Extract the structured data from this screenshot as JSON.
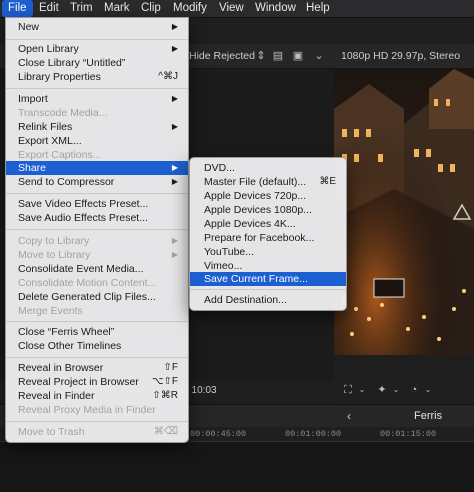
{
  "menubar": {
    "items": [
      "File",
      "Edit",
      "Trim",
      "Mark",
      "Clip",
      "Modify",
      "View",
      "Window",
      "Help"
    ]
  },
  "browser_toolbar": {
    "filter": "Hide Rejected"
  },
  "viewer_toolbar": {
    "format": "1080p HD 29.97p, Stereo"
  },
  "browser_status": {
    "text": ", 10:03"
  },
  "timeline": {
    "name": "Ferris Wheel",
    "ruler": [
      "00:00:45:00",
      "00:01:00:00",
      "00:01:15:00"
    ]
  },
  "file_menu": {
    "items": [
      {
        "label": "New",
        "shortcut": "",
        "submenu": true,
        "disabled": false
      },
      {
        "label": "Open Library",
        "shortcut": "",
        "submenu": true,
        "disabled": false
      },
      {
        "label": "Close Library “Untitled”",
        "shortcut": "",
        "submenu": false,
        "disabled": false
      },
      {
        "label": "Library Properties",
        "shortcut": "^⌘J",
        "submenu": false,
        "disabled": false
      },
      {
        "label": "Import",
        "shortcut": "",
        "submenu": true,
        "disabled": false
      },
      {
        "label": "Transcode Media...",
        "shortcut": "",
        "submenu": false,
        "disabled": true
      },
      {
        "label": "Relink Files",
        "shortcut": "",
        "submenu": true,
        "disabled": false
      },
      {
        "label": "Export XML...",
        "shortcut": "",
        "submenu": false,
        "disabled": false
      },
      {
        "label": "Export Captions...",
        "shortcut": "",
        "submenu": false,
        "disabled": true
      },
      {
        "label": "Share",
        "shortcut": "",
        "submenu": true,
        "disabled": false,
        "highlighted": true
      },
      {
        "label": "Send to Compressor",
        "shortcut": "",
        "submenu": true,
        "disabled": false
      },
      {
        "label": "Save Video Effects Preset...",
        "shortcut": "",
        "submenu": false,
        "disabled": false
      },
      {
        "label": "Save Audio Effects Preset...",
        "shortcut": "",
        "submenu": false,
        "disabled": false
      },
      {
        "label": "Copy to Library",
        "shortcut": "",
        "submenu": true,
        "disabled": true
      },
      {
        "label": "Move to Library",
        "shortcut": "",
        "submenu": true,
        "disabled": true
      },
      {
        "label": "Consolidate Event Media...",
        "shortcut": "",
        "submenu": false,
        "disabled": false
      },
      {
        "label": "Consolidate Motion Content...",
        "shortcut": "",
        "submenu": false,
        "disabled": true
      },
      {
        "label": "Delete Generated Clip Files...",
        "shortcut": "",
        "submenu": false,
        "disabled": false
      },
      {
        "label": "Merge Events",
        "shortcut": "",
        "submenu": false,
        "disabled": true
      },
      {
        "label": "Close “Ferris Wheel”",
        "shortcut": "",
        "submenu": false,
        "disabled": false
      },
      {
        "label": "Close Other Timelines",
        "shortcut": "",
        "submenu": false,
        "disabled": false
      },
      {
        "label": "Reveal in Browser",
        "shortcut": "⇧F",
        "submenu": false,
        "disabled": false
      },
      {
        "label": "Reveal Project in Browser",
        "shortcut": "⌥⇧F",
        "submenu": false,
        "disabled": false
      },
      {
        "label": "Reveal in Finder",
        "shortcut": "⇧⌘R",
        "submenu": false,
        "disabled": false
      },
      {
        "label": "Reveal Proxy Media in Finder",
        "shortcut": "",
        "submenu": false,
        "disabled": true
      },
      {
        "label": "Move to Trash",
        "shortcut": "⌘⌫",
        "submenu": false,
        "disabled": true
      }
    ]
  },
  "share_menu": {
    "items": [
      {
        "label": "DVD...",
        "shortcut": ""
      },
      {
        "label": "Master File (default)...",
        "shortcut": "⌘E"
      },
      {
        "label": "Apple Devices 720p...",
        "shortcut": ""
      },
      {
        "label": "Apple Devices 1080p...",
        "shortcut": ""
      },
      {
        "label": "Apple Devices 4K...",
        "shortcut": ""
      },
      {
        "label": "Prepare for Facebook...",
        "shortcut": ""
      },
      {
        "label": "YouTube...",
        "shortcut": ""
      },
      {
        "label": "Vimeo...",
        "shortcut": ""
      },
      {
        "label": "Save Current Frame...",
        "shortcut": "",
        "highlighted": true
      },
      {
        "label": "Add Destination...",
        "shortcut": ""
      }
    ]
  },
  "colors": {
    "highlight": "#1c5fd0",
    "menu_bg": "#ececee",
    "app_bg": "#1e1e1e"
  }
}
